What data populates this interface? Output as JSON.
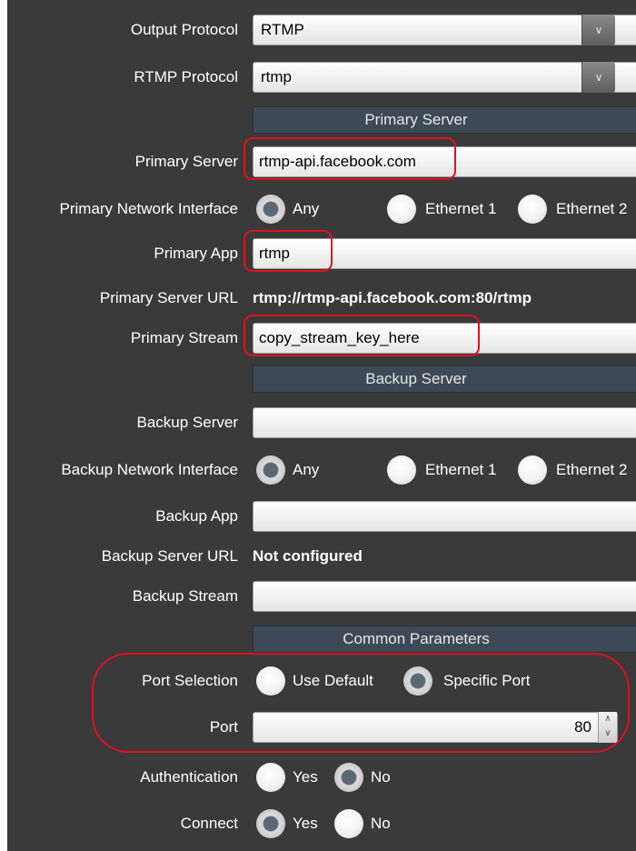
{
  "output_protocol": {
    "label": "Output Protocol",
    "value": "RTMP"
  },
  "rtmp_protocol": {
    "label": "RTMP Protocol",
    "value": "rtmp"
  },
  "primary": {
    "section_title": "Primary Server",
    "server_label": "Primary Server",
    "server_value": "rtmp-api.facebook.com",
    "interface_label": "Primary Network Interface",
    "interface_options": [
      "Any",
      "Ethernet 1",
      "Ethernet 2"
    ],
    "interface_selected": "Any",
    "app_label": "Primary App",
    "app_value": "rtmp",
    "url_label": "Primary Server URL",
    "url_value": "rtmp://rtmp-api.facebook.com:80/rtmp",
    "stream_label": "Primary Stream",
    "stream_value": "copy_stream_key_here"
  },
  "backup": {
    "section_title": "Backup Server",
    "server_label": "Backup Server",
    "server_value": "",
    "interface_label": "Backup Network Interface",
    "interface_options": [
      "Any",
      "Ethernet 1",
      "Ethernet 2"
    ],
    "interface_selected": "Any",
    "app_label": "Backup App",
    "app_value": "",
    "url_label": "Backup Server URL",
    "url_value": "Not configured",
    "stream_label": "Backup Stream",
    "stream_value": ""
  },
  "common": {
    "section_title": "Common Parameters",
    "port_selection_label": "Port Selection",
    "port_selection_options": [
      "Use Default",
      "Specific Port"
    ],
    "port_selection_selected": "Specific Port",
    "port_label": "Port",
    "port_value": "80",
    "auth_label": "Authentication",
    "auth_options": [
      "Yes",
      "No"
    ],
    "auth_selected": "No",
    "connect_label": "Connect",
    "connect_options": [
      "Yes",
      "No"
    ],
    "connect_selected": "Yes"
  },
  "colors": {
    "background": "#3a3a3a",
    "section_header": "#3d4a56",
    "highlight": "#e0121e",
    "radio_selected": "#5a6874"
  },
  "icons": {
    "dropdown": "chevron-down-icon",
    "stepper": "spin-arrows-icon"
  }
}
